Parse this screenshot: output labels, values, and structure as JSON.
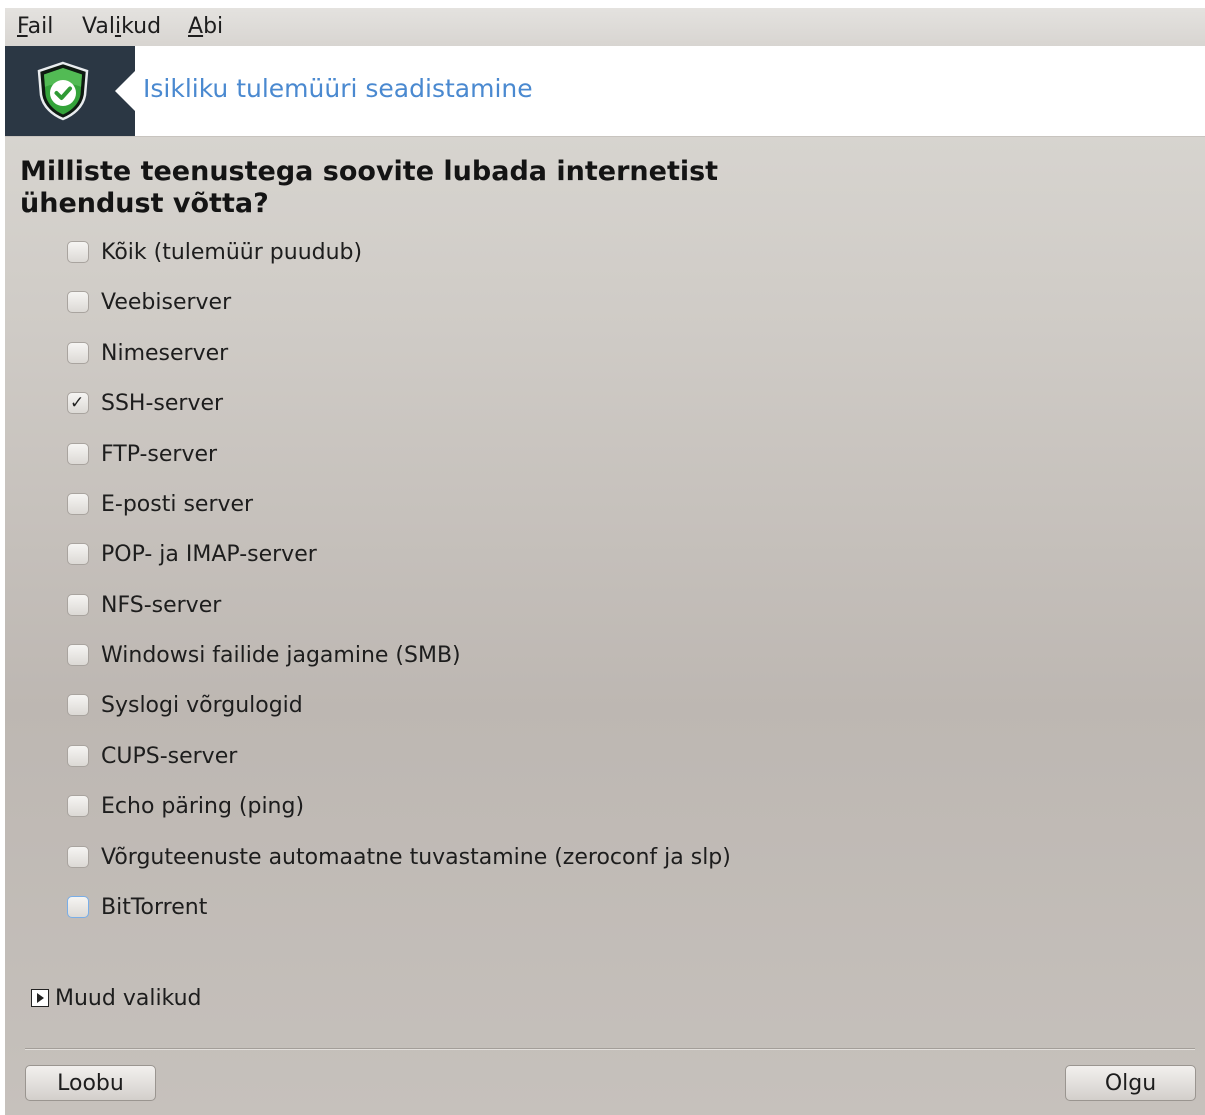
{
  "menubar": {
    "items": [
      {
        "label_underlined": "F",
        "label_rest": "ail"
      },
      {
        "label_pre": "Val",
        "label_underlined": "i",
        "label_rest": "kud"
      },
      {
        "label_underlined": "A",
        "label_rest": "bi"
      }
    ]
  },
  "banner": {
    "title": "Isikliku tulemüüri seadistamine",
    "icon": "shield-check-icon",
    "colors": {
      "logo_bg": "#2b3744",
      "shield": "#3aa13a",
      "title": "#4a89d0"
    }
  },
  "question": "Milliste teenustega soovite lubada internetist ühendust võtta?",
  "services": [
    {
      "label": "Kõik (tulemüür puudub)",
      "checked": false
    },
    {
      "label": "Veebiserver",
      "checked": false
    },
    {
      "label": "Nimeserver",
      "checked": false
    },
    {
      "label": "SSH-server",
      "checked": true
    },
    {
      "label": "FTP-server",
      "checked": false
    },
    {
      "label": "E-posti server",
      "checked": false
    },
    {
      "label": "POP- ja IMAP-server",
      "checked": false
    },
    {
      "label": "NFS-server",
      "checked": false
    },
    {
      "label": "Windowsi failide jagamine (SMB)",
      "checked": false
    },
    {
      "label": "Syslogi võrgulogid",
      "checked": false
    },
    {
      "label": "CUPS-server",
      "checked": false
    },
    {
      "label": "Echo päring (ping)",
      "checked": false
    },
    {
      "label": "Võrguteenuste automaatne tuvastamine (zeroconf ja slp)",
      "checked": false
    },
    {
      "label": "BitTorrent",
      "checked": false,
      "focused": true
    }
  ],
  "more_options": {
    "label": "Muud valikud",
    "icon": "expander-arrow-icon"
  },
  "buttons": {
    "cancel": "Loobu",
    "ok": "Olgu"
  }
}
